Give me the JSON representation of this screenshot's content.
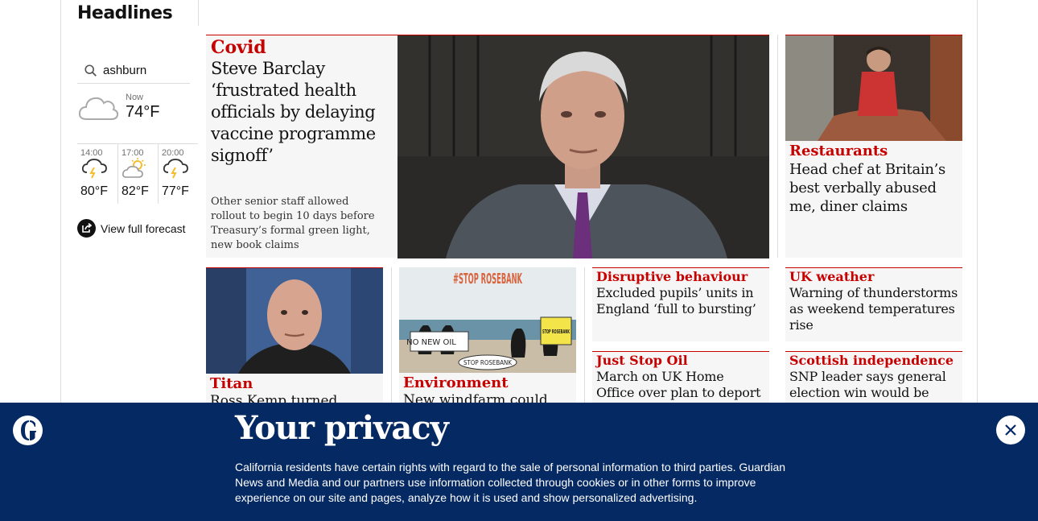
{
  "section": {
    "title": "Headlines"
  },
  "weather": {
    "location": "ashburn",
    "now_label": "Now",
    "now_temp": "74°F",
    "now_icon": "cloud-icon",
    "forecast": [
      {
        "time": "14:00",
        "temp": "80°F",
        "icon": "thunderstorm-icon"
      },
      {
        "time": "17:00",
        "temp": "82°F",
        "icon": "sun-cloud-icon"
      },
      {
        "time": "20:00",
        "temp": "77°F",
        "icon": "thunderstorm-icon"
      }
    ],
    "view_full_label": "View full forecast"
  },
  "hero": {
    "kicker": "Covid",
    "headline": "Steve Barclay ‘frustrated health officials by delaying vaccine programme signoff’",
    "standfirst": "Other senior staff allowed rollout to begin 10 days before Treasury’s formal green light, new book claims"
  },
  "right_top": {
    "kicker": "Restaurants",
    "headline": "Head chef at Britain’s best verbally abused me, diner claims"
  },
  "cards": [
    {
      "kicker": "Titan",
      "headline": "Ross Kemp turned"
    },
    {
      "kicker": "Environment",
      "headline": "New windfarm could"
    },
    {
      "kicker": "Disruptive behaviour",
      "headline": "Excluded pupils’ units in England ‘full to bursting’"
    },
    {
      "kicker": "UK weather",
      "headline": "Warning of thunderstorms as weekend temperatures rise"
    },
    {
      "kicker": "Just Stop Oil",
      "headline": "March on UK Home Office over plan to deport jailed"
    },
    {
      "kicker": "Scottish independence",
      "headline": "SNP leader says general election win would be"
    }
  ],
  "protest_signs": {
    "banner": "#STOP ROSEBANK",
    "sign1": "NO NEW OIL",
    "sign2": "STOP ROSEBANK",
    "sign3": "STOP ROSEBANK"
  },
  "privacy": {
    "title": "Your privacy",
    "body": "California residents have certain rights with regard to the sale of personal information to third parties. Guardian News and Media and our partners use information collected through cookies or in other forms to improve experience on our site and pages, analyze how it is used and show personalized advertising."
  },
  "colors": {
    "brand_red": "#c70000",
    "privacy_bg": "#052962"
  }
}
